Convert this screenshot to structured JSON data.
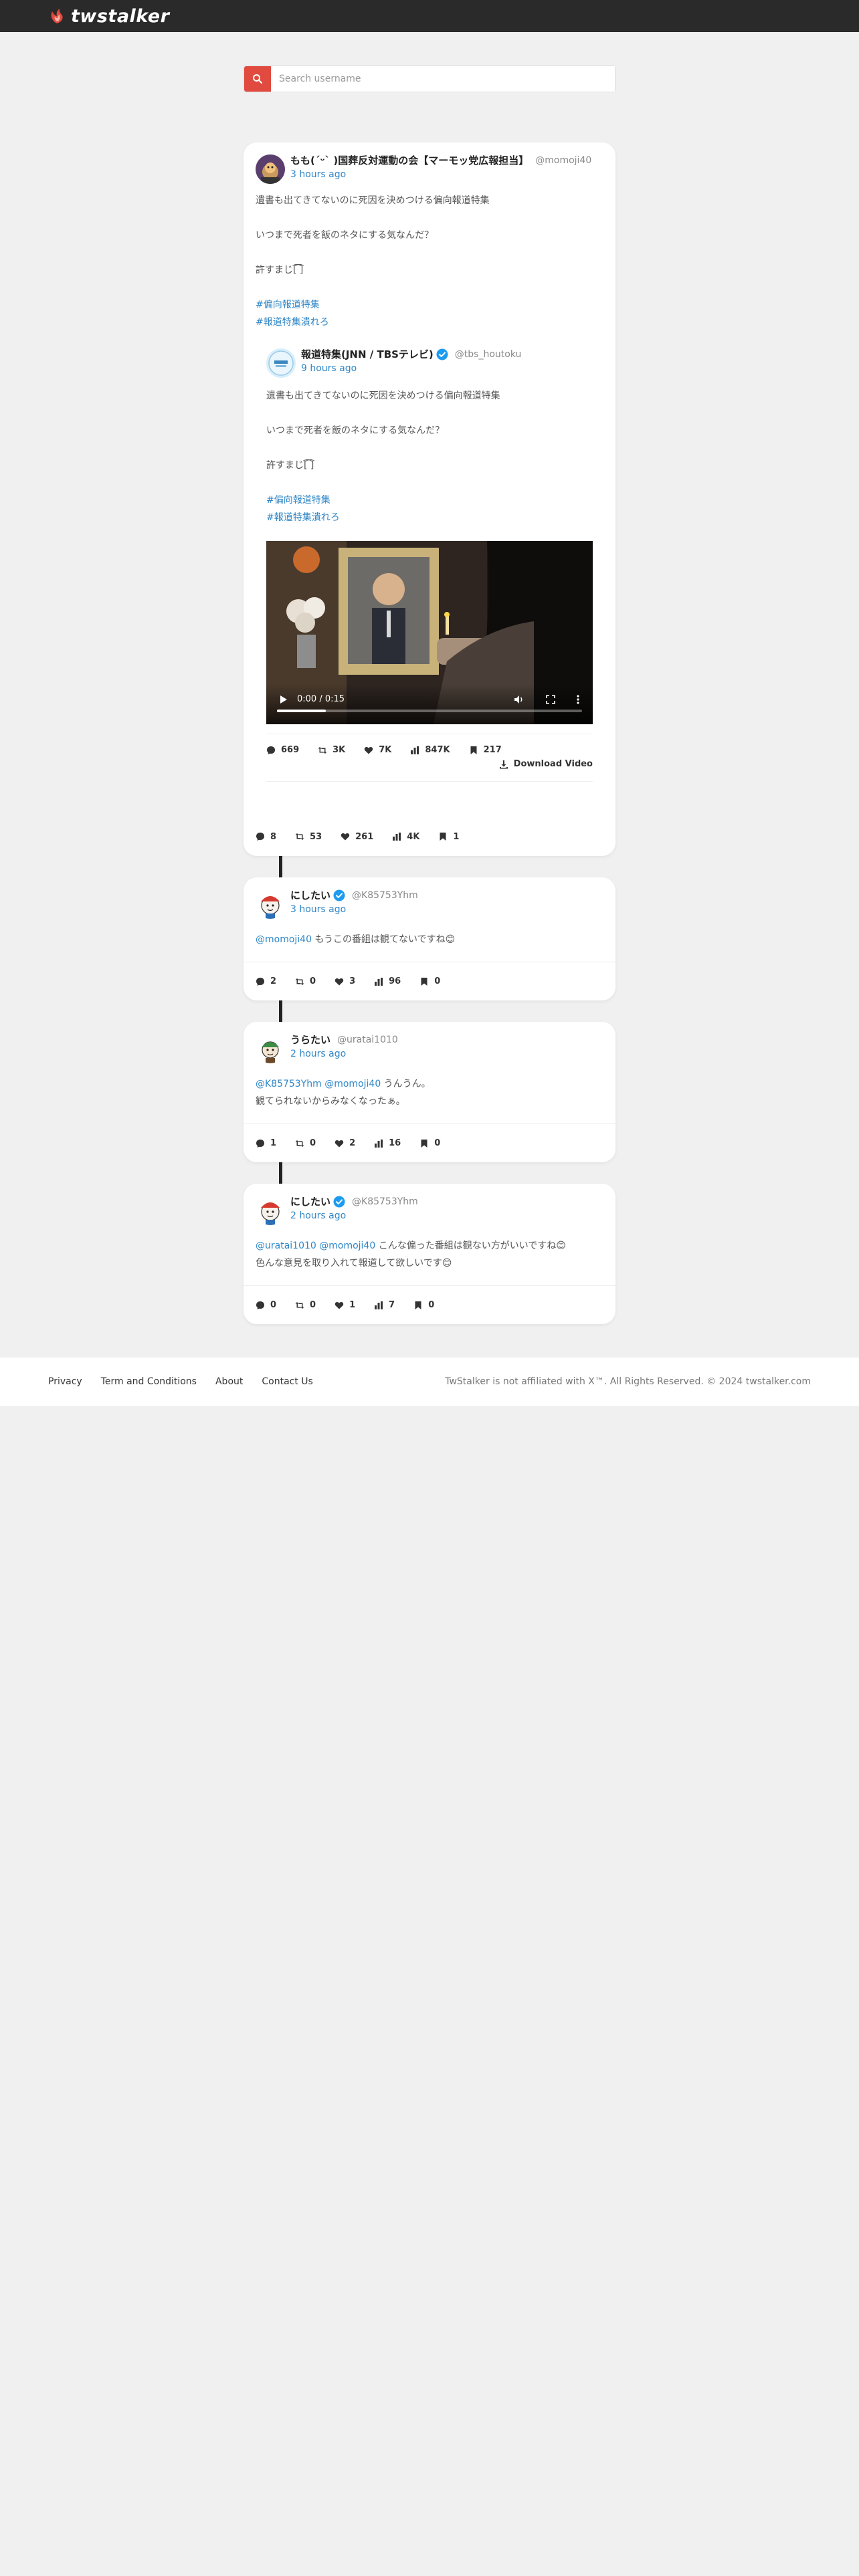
{
  "app": {
    "logo_text": "twstalker",
    "brand_color": "#e04a3f"
  },
  "search": {
    "placeholder": "Search username",
    "value": ""
  },
  "main_post": {
    "name": "もも(ˊᵕˋ\t)国葬反対運動の会【マーモッ党広報担当】",
    "handle": "@momoji40",
    "time": "3 hours ago",
    "lines": [
      "遺書も出てきてないのに死因を決めつける偏向報道特集",
      "",
      "いつまで死者を飯のネタにする気なんだ？",
      "",
      "許すまじ[͡ ͡]"
    ],
    "hashtags": [
      "#偏向報道特集",
      "#報道特集潰れろ"
    ],
    "stats": {
      "replies": "8",
      "retweets": "53",
      "likes": "261",
      "views": "4K",
      "bookmarks": "1"
    }
  },
  "quoted_post": {
    "name": "報道特集(JNN / TBSテレビ)",
    "handle": "@tbs_houtoku",
    "time": "9 hours ago",
    "lines": [
      "遺書も出てきてないのに死因を決めつける偏向報道特集",
      "",
      "いつまで死者を飯のネタにする気なんだ？",
      "",
      "許すまじ[͡ ͡]"
    ],
    "hashtags": [
      "#偏向報道特集",
      "#報道特集潰れろ"
    ],
    "video": {
      "time": "0:00 / 0:15",
      "progress": 0.16
    },
    "stats": {
      "replies": "669",
      "retweets": "3K",
      "likes": "7K",
      "views": "847K",
      "bookmarks": "217"
    },
    "download_label": "Download Video"
  },
  "replies": [
    {
      "name": "にしたい",
      "handle": "@K85753Yhm",
      "time": "3 hours ago",
      "mentions": "@momoji40",
      "text": " もうこの番組は観てないですね😊",
      "line2": "",
      "stats": {
        "replies": "2",
        "retweets": "0",
        "likes": "3",
        "views": "96",
        "bookmarks": "0"
      }
    },
    {
      "name": "うらたい",
      "handle": "@uratai1010",
      "time": "2 hours ago",
      "mentions": "@K85753Yhm @momoji40",
      "text": " うんうん。",
      "line2": "観てられないからみなくなったぁ。",
      "stats": {
        "replies": "1",
        "retweets": "0",
        "likes": "2",
        "views": "16",
        "bookmarks": "0"
      }
    },
    {
      "name": "にしたい",
      "handle": "@K85753Yhm",
      "time": "2 hours ago",
      "mentions": "@uratai1010 @momoji40",
      "text": " こんな偏った番組は観ない方がいいですね😊",
      "line2": "色んな意見を取り入れて報道して欲しいです😊",
      "stats": {
        "replies": "0",
        "retweets": "0",
        "likes": "1",
        "views": "7",
        "bookmarks": "0"
      }
    }
  ],
  "footer": {
    "links": [
      "Privacy",
      "Term and Conditions",
      "About",
      "Contact Us"
    ],
    "copyright": "TwStalker is not affiliated with X™. All Rights Reserved. © 2024 twstalker.com"
  }
}
